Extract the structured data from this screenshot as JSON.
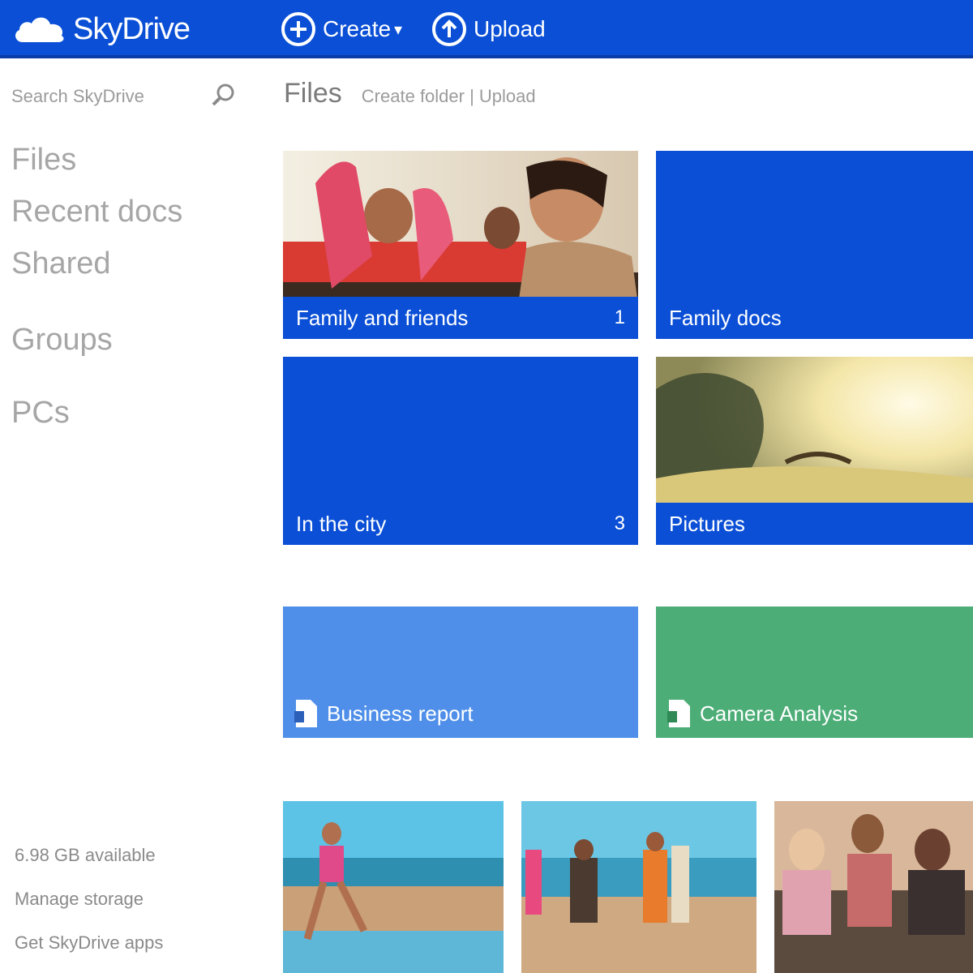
{
  "colors": {
    "brand": "#0a4fd6",
    "tile_blue": "#0a4fd6",
    "tile_light_blue": "#4f8fe9",
    "tile_green": "#4cad77"
  },
  "header": {
    "brand": "SkyDrive",
    "create_label": "Create",
    "upload_label": "Upload",
    "icons": {
      "logo": "cloud-icon",
      "create": "plus-circle-icon",
      "upload": "upload-arrow-icon"
    }
  },
  "search": {
    "placeholder": "Search SkyDrive",
    "icon": "search-icon"
  },
  "sidebar": {
    "items": [
      {
        "label": "Files"
      },
      {
        "label": "Recent docs"
      },
      {
        "label": "Shared"
      },
      {
        "label": "Groups"
      },
      {
        "label": "PCs"
      }
    ],
    "footer": [
      {
        "label": "6.98 GB available"
      },
      {
        "label": "Manage storage"
      },
      {
        "label": "Get SkyDrive apps"
      }
    ]
  },
  "breadcrumb": {
    "title": "Files",
    "subtitle": "Create folder | Upload"
  },
  "folders": [
    {
      "label": "Family and friends",
      "count": "1"
    },
    {
      "label": "Family docs",
      "count": ""
    },
    {
      "label": "In the city",
      "count": "3"
    },
    {
      "label": "Pictures",
      "count": ""
    }
  ],
  "documents": [
    {
      "label": "Business report",
      "icon": "document-icon"
    },
    {
      "label": "Camera Analysis",
      "icon": "document-icon"
    }
  ]
}
